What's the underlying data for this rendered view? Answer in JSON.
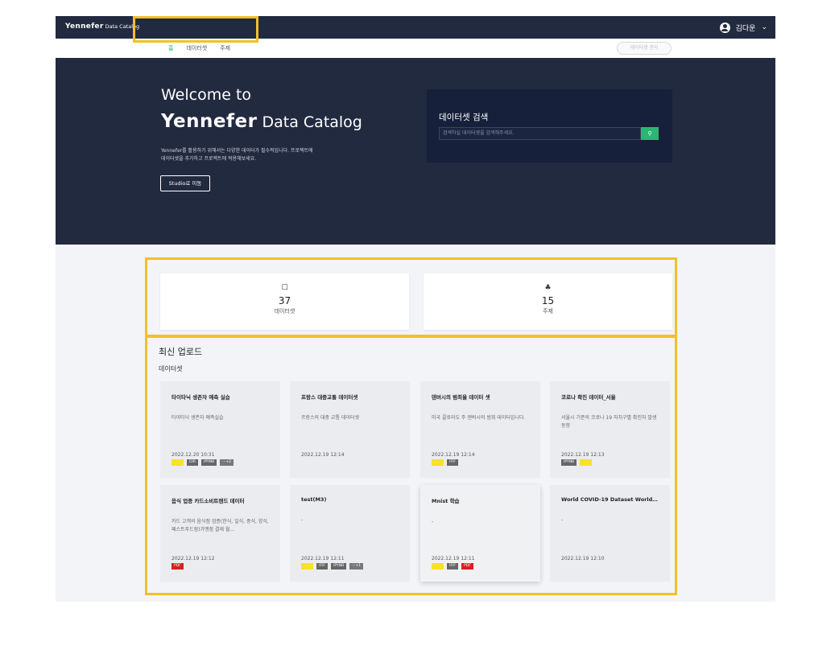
{
  "topbar": {
    "brand": "Yennefer",
    "brand_suffix": "Data Catalog",
    "user_name": "김다운",
    "user_icon": "user-circle-icon",
    "chevron": "⌄"
  },
  "nav": {
    "items": [
      "홈",
      "데이터셋",
      "주제"
    ],
    "active_index": 0,
    "settings_label": "데이터셋 관리"
  },
  "hero": {
    "welcome": "Welcome to",
    "brand": "Yennefer",
    "brand_suffix": "Data Catalog",
    "description_line1": "Yennefer를 활용하기 위해서는 다양한 데이터가 필수적입니다. 프로젝트에",
    "description_line2": "데이터셋을 추가하고 프로젝트에 적용해보세요.",
    "studio_button": "Studio로 이동",
    "search_title": "데이터셋 검색",
    "search_placeholder": "검색하실 데이터셋을 검색해주세요.",
    "search_icon": "search-icon"
  },
  "stats": [
    {
      "icon": "archive-icon",
      "glyph": "☐",
      "value": "37",
      "label": "데이터셋"
    },
    {
      "icon": "sitemap-icon",
      "glyph": "♣",
      "value": "15",
      "label": "주제"
    }
  ],
  "recent": {
    "title": "최신 업로드",
    "subtitle": "데이터셋",
    "cards": [
      {
        "title": "타이타닉 생존자 예측 실습",
        "desc": "타이타닉 생존자 예측실습",
        "date": "2022.12.20 10:31",
        "tags": [
          "CSV",
          "DIR",
          "IPYNB",
          "+2"
        ]
      },
      {
        "title": "프랑스 대중교통 데이터셋",
        "desc": "프랑스의 대중 교통 데이터셋",
        "date": "2022.12.19 12:14",
        "tags": []
      },
      {
        "title": "덴버시의 범죄율 데이터 셋",
        "desc": "미국 콜로라도 주 덴버시의 범죄 데이터입니다.",
        "date": "2022.12.19 12:14",
        "tags": [
          "CSV",
          "IFIF"
        ]
      },
      {
        "title": "코로나 확진 데이터_서울",
        "desc": "서울시 기준의 코로나 19 자치구별 확진자 발생 동향",
        "date": "2022.12.19 12:13",
        "tags": [
          "IPYNB",
          "CSV"
        ]
      },
      {
        "title": "음식 업종 카드소비트렌드 데이터",
        "desc": "카드 고객의 음식점 업종(한식, 일식, 중식, 양식, 패스트푸드점)가맹점 결제 월...",
        "date": "2022.12.19 12:12",
        "tags": [
          "PDF"
        ]
      },
      {
        "title": "test(M3)",
        "desc": "-",
        "date": "2022.12.19 12:11",
        "tags": [
          "CSV",
          "IFIF",
          "IPYNB",
          "+1"
        ]
      },
      {
        "title": "Mnist 학습",
        "desc": "-",
        "date": "2022.12.19 12:11",
        "tags": [
          "CSV",
          "IFIF",
          "PDF"
        ]
      },
      {
        "title": "World COVID-19 Dataset World ...",
        "desc": "-",
        "date": "2022.12.19 12:10",
        "tags": []
      }
    ]
  },
  "colors": {
    "navy": "#222a40",
    "accent_green": "#2bb673",
    "highlight_yellow": "#f2c028",
    "csv_tag": "#f7e227",
    "pdf_tag": "#d8201f"
  }
}
